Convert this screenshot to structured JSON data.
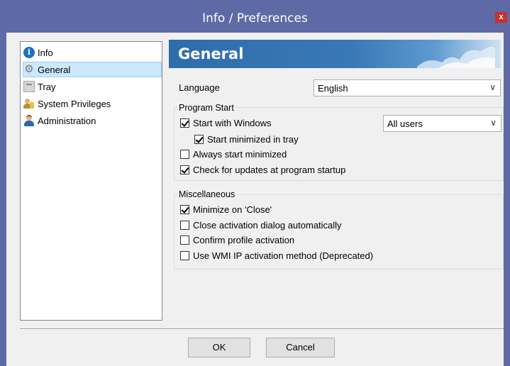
{
  "window": {
    "title": "Info / Preferences",
    "close_glyph": "x"
  },
  "sidebar": {
    "items": [
      {
        "label": "Info",
        "icon": "info-icon",
        "selected": false
      },
      {
        "label": "General",
        "icon": "gear-icon",
        "selected": true
      },
      {
        "label": "Tray",
        "icon": "tray-icon",
        "selected": false
      },
      {
        "label": "System Privileges",
        "icon": "privileges-icon",
        "selected": false
      },
      {
        "label": "Administration",
        "icon": "admin-user-icon",
        "selected": false
      }
    ]
  },
  "panel": {
    "title": "General",
    "language": {
      "label": "Language",
      "value": "English"
    },
    "program_start": {
      "legend": "Program Start",
      "start_with_windows": {
        "label": "Start with Windows",
        "checked": true
      },
      "users_select": {
        "value": "All users"
      },
      "start_minimized_tray": {
        "label": "Start minimized in tray",
        "checked": true
      },
      "always_start_minimized": {
        "label": "Always start minimized",
        "checked": false
      },
      "check_updates": {
        "label": "Check for updates at program startup",
        "checked": true
      }
    },
    "misc": {
      "legend": "Miscellaneous",
      "minimize_on_close": {
        "label": "Minimize on 'Close'",
        "checked": true
      },
      "close_activation_dialog": {
        "label": "Close activation dialog automatically",
        "checked": false
      },
      "confirm_profile": {
        "label": "Confirm profile activation",
        "checked": false
      },
      "wmi_ip": {
        "label": "Use WMI IP activation method (Deprecated)",
        "checked": false
      }
    }
  },
  "buttons": {
    "ok": "OK",
    "cancel": "Cancel"
  },
  "colors": {
    "titlebar": "#5e6aa5",
    "banner": "#2f6daa",
    "close": "#c7312e",
    "selection": "#cce8ff"
  }
}
